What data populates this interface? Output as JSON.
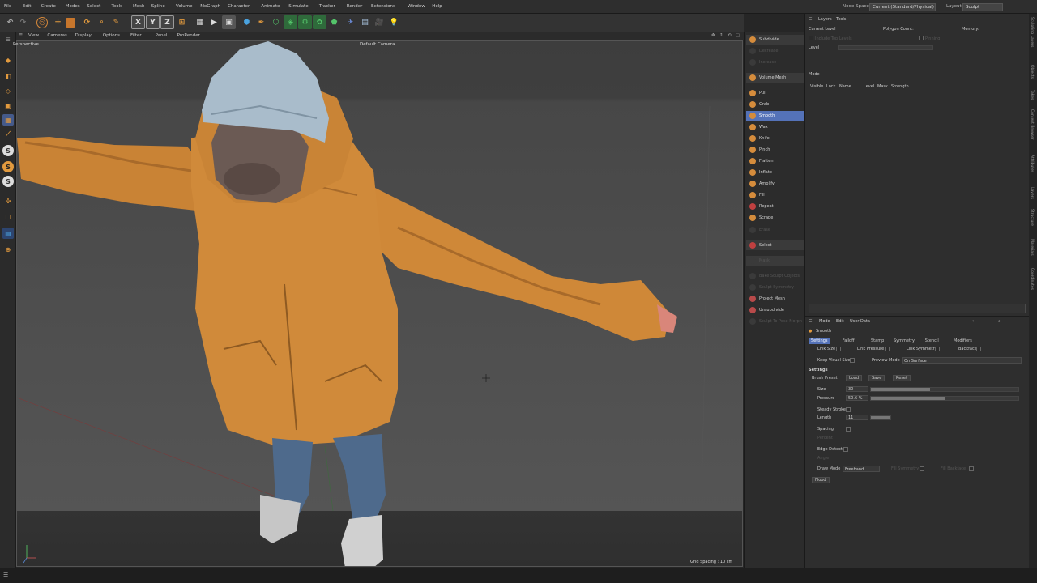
{
  "menubar": {
    "items": [
      "File",
      "Edit",
      "Create",
      "Modes",
      "Select",
      "Tools",
      "Mesh",
      "Spline",
      "Volume",
      "MoGraph",
      "Character",
      "Animate",
      "Simulate",
      "Tracker",
      "Render",
      "Extensions",
      "Window",
      "Help"
    ],
    "node_space_label": "Node Space:",
    "node_space_value": "Current (Standard/Physical)",
    "layout_label": "Layout:",
    "layout_value": "Sculpt"
  },
  "toolbar": {
    "axis_x": "X",
    "axis_y": "Y",
    "axis_z": "Z"
  },
  "viewport_menu": {
    "items": [
      "View",
      "Cameras",
      "Display",
      "Options",
      "Filter",
      "Panel",
      "ProRender"
    ]
  },
  "viewport": {
    "projection": "Perspective",
    "camera": "Default Camera",
    "grid_spacing": "Grid Spacing : 10 cm"
  },
  "brush_panel": {
    "subdivide": "Subdivide",
    "decrease": "Decrease",
    "increase": "Increase",
    "volume_mesh": "Volume Mesh",
    "brushes": [
      "Pull",
      "Grab",
      "Smooth",
      "Wax",
      "Knife",
      "Pinch",
      "Flatten",
      "Inflate",
      "Amplify",
      "Fill",
      "Repeat",
      "Scrape"
    ],
    "active_brush": "Smooth",
    "erase": "Erase",
    "select": "Select",
    "mask": "Mask",
    "bake": "Bake Sculpt Objects",
    "sculpt_symmetry": "Sculpt Symmetry",
    "project_mesh": "Project Mesh",
    "unsubdivide": "Unsubdivide",
    "sculpt_to_pose": "Sculpt To Pose Morph"
  },
  "layers_panel": {
    "tabs": [
      "Layers",
      "Tools"
    ],
    "current_level": "Current Level",
    "polygon_count": "Polygon Count:",
    "memory": "Memory:",
    "include_top_levels": "Include Top Levels",
    "pinning": "Pinning",
    "level": "Level",
    "mode": "Mode",
    "columns": [
      "Visible",
      "Lock",
      "Name",
      "Level",
      "Mask",
      "Strength"
    ]
  },
  "attributes": {
    "menu": [
      "Mode",
      "Edit",
      "User Data"
    ],
    "title": "Smooth",
    "tabs": [
      "Settings",
      "Falloff",
      "Stamp",
      "Symmetry",
      "Stencil",
      "Modifiers"
    ],
    "link_size": "Link Size",
    "link_pressure": "Link Pressure",
    "link_symmetry": "Link Symmetry",
    "backface": "Backface",
    "keep_visual_size": "Keep Visual Size",
    "preview_mode": "Preview Mode",
    "preview_mode_value": "On Surface",
    "section": "Settings",
    "brush_preset": "Brush Preset",
    "load": "Load",
    "save": "Save",
    "reset": "Reset",
    "size_label": "Size",
    "size_value": "30",
    "size_fill": 0.4,
    "pressure_label": "Pressure",
    "pressure_value": "50.6 %",
    "pressure_fill": 0.506,
    "steady_stroke": "Steady Stroke",
    "length_label": "Length",
    "length_value": "11",
    "spacing": "Spacing",
    "percent": "Percent",
    "edge_detect": "Edge Detect",
    "angle": "Angle",
    "draw_mode_label": "Draw Mode",
    "draw_mode_value": "Freehand",
    "fill_symmetry": "Fill Symmetry",
    "fill_backface": "Fill Backface",
    "flood": "Flood"
  },
  "right_strip": [
    "Sculpting Layers",
    "Objects",
    "Takes",
    "Content Browser",
    "Attributes",
    "Layers",
    "Structure",
    "Materials",
    "Coordinates"
  ],
  "colors": {
    "accent": "#5472b8",
    "jacket": "#d28a3a",
    "beanie": "#9fb6c8"
  }
}
